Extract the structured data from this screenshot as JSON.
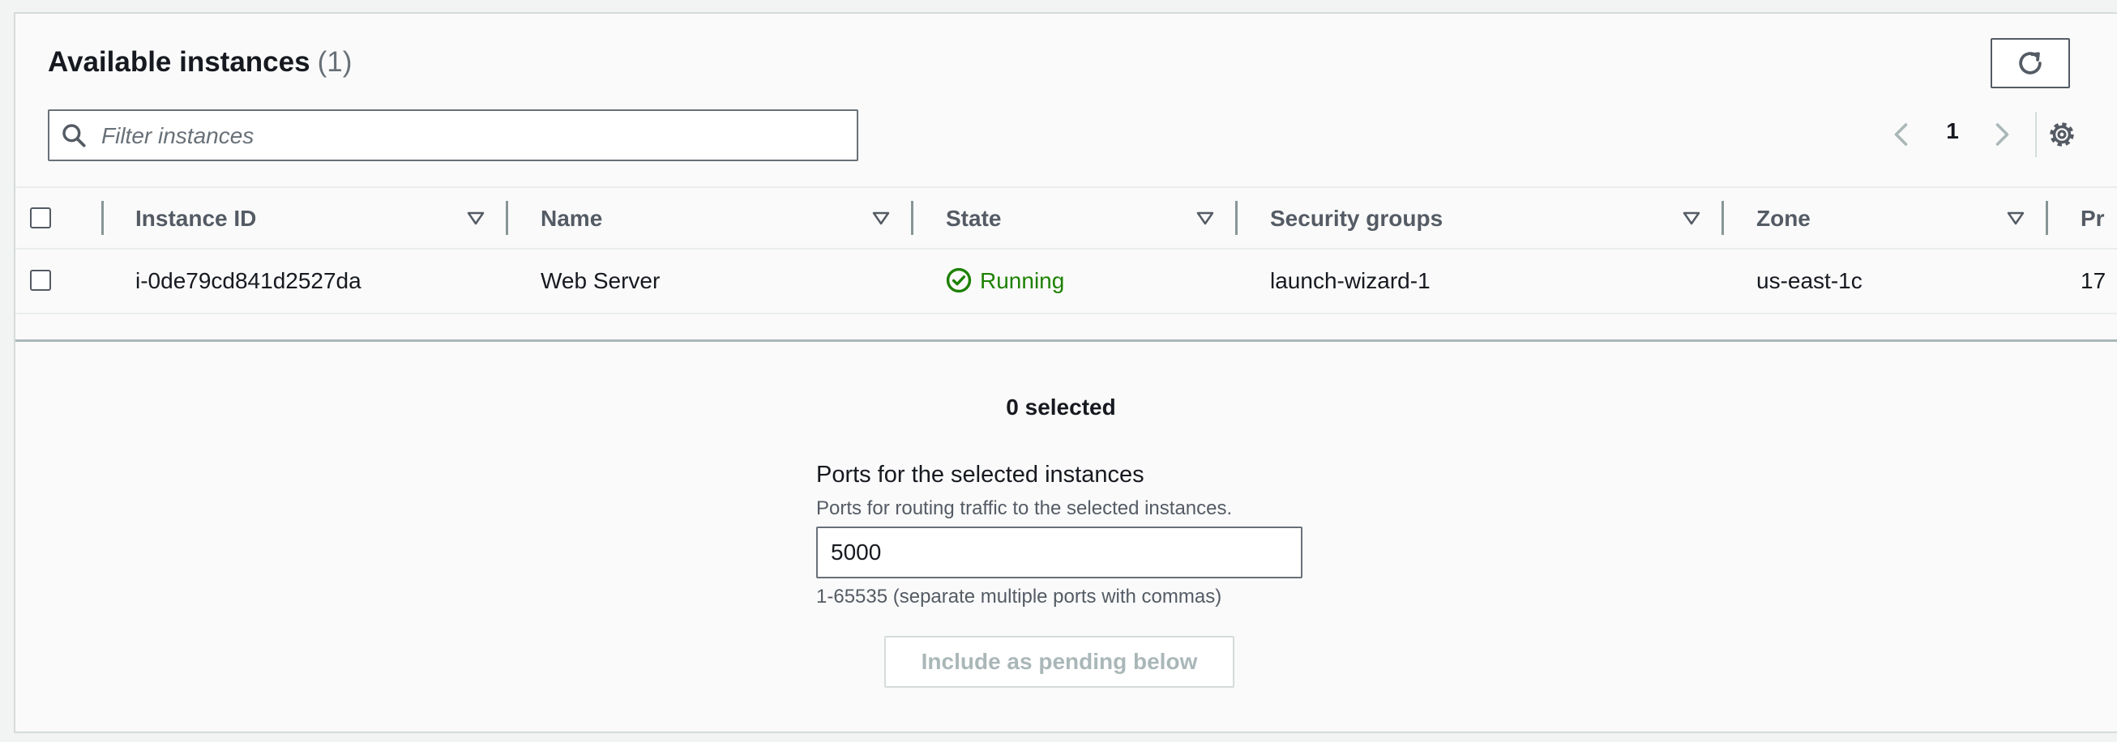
{
  "header": {
    "title": "Available instances",
    "count": "(1)"
  },
  "search": {
    "placeholder": "Filter instances"
  },
  "pagination": {
    "current_page": "1"
  },
  "table": {
    "columns": [
      {
        "label": "Instance ID"
      },
      {
        "label": "Name"
      },
      {
        "label": "State"
      },
      {
        "label": "Security groups"
      },
      {
        "label": "Zone"
      },
      {
        "label": "Pr"
      }
    ],
    "rows": [
      {
        "instance_id": "i-0de79cd841d2527da",
        "name": "Web Server",
        "state": "Running",
        "security_groups": "launch-wizard-1",
        "zone": "us-east-1c",
        "private_ip": "17"
      }
    ]
  },
  "selection": {
    "count_text": "0 selected"
  },
  "ports": {
    "label": "Ports for the selected instances",
    "description": "Ports for routing traffic to the selected instances.",
    "value": "5000",
    "hint": "1-65535 (separate multiple ports with commas)"
  },
  "actions": {
    "include_label": "Include as pending below"
  },
  "colors": {
    "status_running": "#1d8102",
    "disabled_text": "#aab7b8",
    "border": "#687078"
  },
  "icons": {
    "refresh": "refresh-icon",
    "search": "search-icon",
    "prev": "chevron-left-icon",
    "next": "chevron-right-icon",
    "settings": "gear-icon",
    "sort": "sort-down-icon",
    "status": "check-circle-icon"
  }
}
